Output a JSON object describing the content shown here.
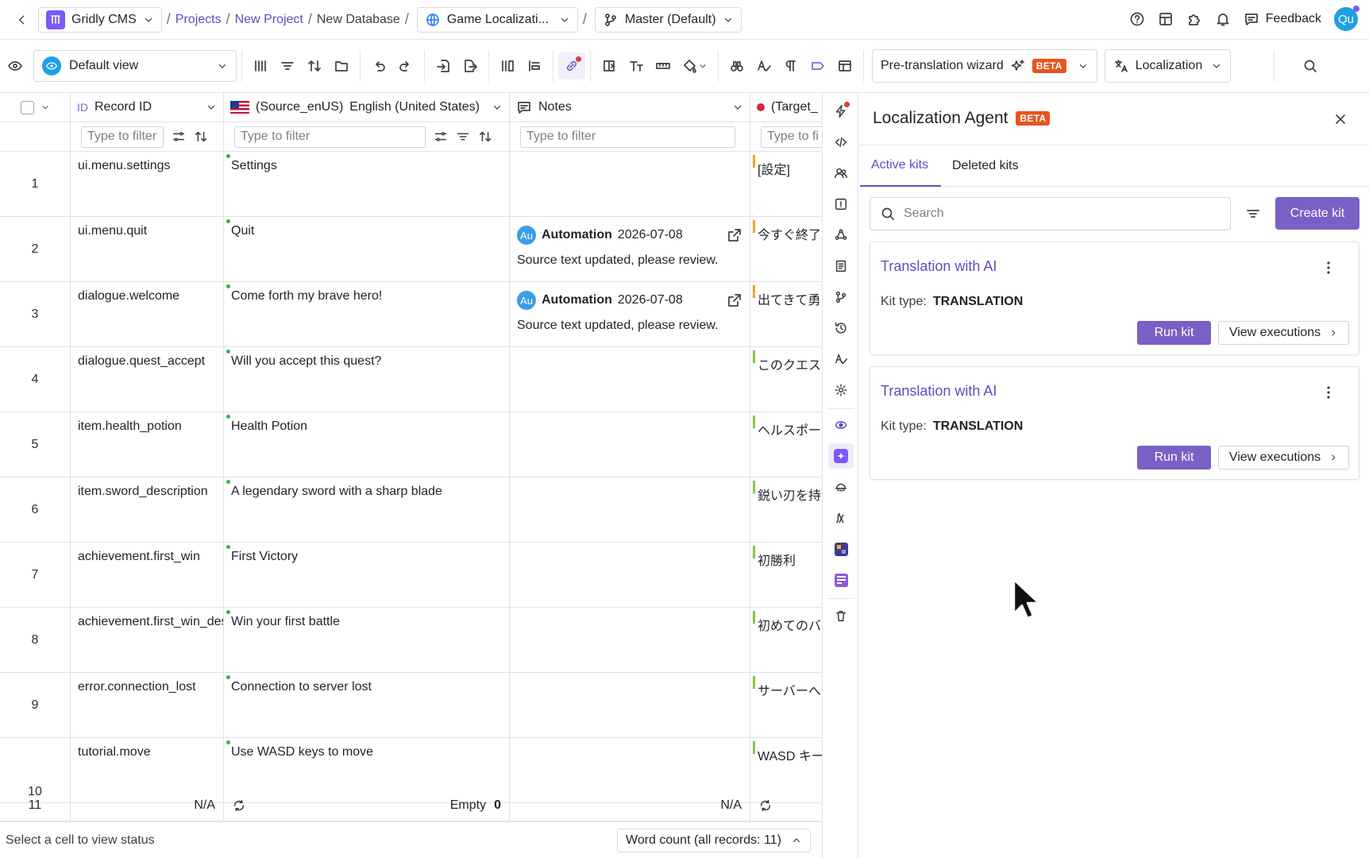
{
  "topbar": {
    "app": "Gridly CMS",
    "breadcrumbs": [
      "Projects",
      "New Project",
      "New Database"
    ],
    "grid_name": "Game Localizati...",
    "branch": "Master (Default)",
    "feedback": "Feedback",
    "avatar": "Qu"
  },
  "toolbar": {
    "view": "Default view",
    "wizard": "Pre-translation wizard",
    "beta": "BETA",
    "localization": "Localization"
  },
  "grid": {
    "columns": {
      "record_id_prefix": "ID",
      "record_id": "Record ID",
      "source_code": "(Source_enUS)",
      "source_name": "English (United States)",
      "notes": "Notes",
      "target": "(Target_"
    },
    "filters": {
      "record": "Type to filter",
      "source": "Type to filter",
      "notes": "Type to filter",
      "target": "Type to fi"
    },
    "rows": [
      {
        "num": "1",
        "id": "ui.menu.settings",
        "source": "Settings",
        "target": "[設定]",
        "note": null
      },
      {
        "num": "2",
        "id": "ui.menu.quit",
        "source": "Quit",
        "target": "今すぐ終了",
        "note": {
          "author": "Automation",
          "date": "2026-07-08",
          "text": "Source text updated, please review."
        }
      },
      {
        "num": "3",
        "id": "dialogue.welcome",
        "source": "Come forth my brave hero!",
        "target": "出てきて勇",
        "note": {
          "author": "Automation",
          "date": "2026-07-08",
          "text": "Source text updated, please review."
        }
      },
      {
        "num": "4",
        "id": "dialogue.quest_accept",
        "source": "Will you accept this quest?",
        "target": "このクエス",
        "note": null
      },
      {
        "num": "5",
        "id": "item.health_potion",
        "source": "Health Potion",
        "target": "ヘルスポー",
        "note": null
      },
      {
        "num": "6",
        "id": "item.sword_description",
        "source": "A legendary sword with a sharp blade",
        "target": "鋭い刃を持",
        "note": null
      },
      {
        "num": "7",
        "id": "achievement.first_win",
        "source": "First Victory",
        "target": "初勝利",
        "note": null
      },
      {
        "num": "8",
        "id": "achievement.first_win_desc",
        "source": "Win your first battle",
        "target": "初めてのバ",
        "note": null
      },
      {
        "num": "9",
        "id": "error.connection_lost",
        "source": "Connection to server lost",
        "target": "サーバーへ",
        "note": null
      },
      {
        "num": "10",
        "id": "tutorial.move",
        "source": "Use WASD keys to move",
        "target": "WASD キー",
        "note": null
      }
    ],
    "footer": {
      "count": "11",
      "record_na": "N/A",
      "source_empty": "Empty",
      "source_empty_count": "0",
      "notes_na": "N/A"
    }
  },
  "statusbar": {
    "text": "Select a cell to view status",
    "word_count": "Word count (all records: 11)"
  },
  "panel": {
    "title": "Localization Agent",
    "beta": "BETA",
    "tabs": [
      "Active kits",
      "Deleted kits"
    ],
    "search_placeholder": "Search",
    "create": "Create kit",
    "kits": [
      {
        "title": "Translation with AI",
        "type_label": "Kit type:",
        "type": "TRANSLATION",
        "run": "Run kit",
        "executions": "View executions"
      },
      {
        "title": "Translation with AI",
        "type_label": "Kit type:",
        "type": "TRANSLATION",
        "run": "Run kit",
        "executions": "View executions"
      }
    ]
  },
  "colors": {
    "accent": "#5b4fc4",
    "button": "#7a5fc7",
    "beta": "#e8541e"
  }
}
